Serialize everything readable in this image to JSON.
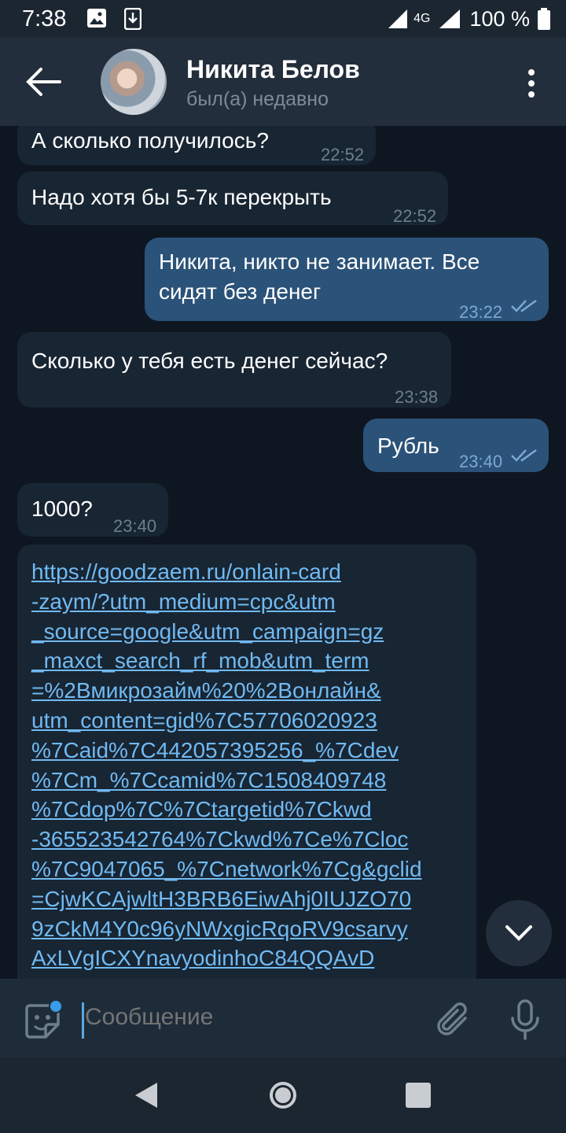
{
  "status": {
    "time": "7:38",
    "network": "4G",
    "battery": "100 %"
  },
  "header": {
    "name": "Никита Белов",
    "last_seen": "был(а) недавно"
  },
  "messages": [
    {
      "dir": "in",
      "text": "А сколько получилось?",
      "time": "22:52"
    },
    {
      "dir": "in",
      "text": "Надо хотя бы 5-7к перекрыть",
      "time": "22:52"
    },
    {
      "dir": "out",
      "lines": [
        "Никита, никто не занимает. Все",
        "сидят без денег"
      ],
      "time": "23:22",
      "read": true
    },
    {
      "dir": "in",
      "text": "Сколько у тебя есть денег сейчас?",
      "time": "23:38"
    },
    {
      "dir": "out",
      "text": "Рубль",
      "time": "23:40",
      "read": true
    },
    {
      "dir": "in",
      "text": "1000?",
      "time": "23:40"
    },
    {
      "dir": "in",
      "link_lines": [
        "https://goodzaem.ru/onlain-card",
        "-zaym/?utm_medium=cpc&utm",
        "_source=google&utm_campaign=gz",
        "_maxct_search_rf_mob&utm_term",
        "=%2Bмикрозайм%20%2Bонлайн&",
        "utm_content=gid%7C57706020923",
        "%7Caid%7C442057395256_%7Cdev",
        "%7Cm_%7Ccamid%7C1508409748",
        "%7Cdop%7C%7Ctargetid%7Ckwd",
        "-365523542764%7Ckwd%7Ce%7Cloc",
        "%7C9047065_%7Cnetwork%7Cg&gclid",
        "=CjwKCAjwltH3BRB6EiwAhj0IUJZO70",
        "9zCkM4Y0c96yNWxgicRqoRV9csarvy",
        "AxLVgICXYnavyodinhoC84QQAvD"
      ]
    }
  ],
  "input": {
    "placeholder": "Сообщение"
  },
  "colors": {
    "incoming": "#182533",
    "outgoing": "#2b5278",
    "link": "#71baf2",
    "background": "#0e1621"
  }
}
